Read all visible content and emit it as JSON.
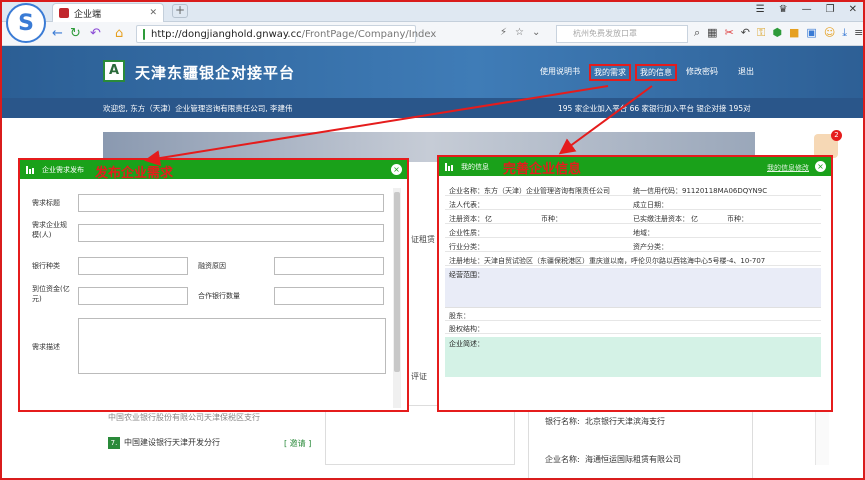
{
  "browser": {
    "tab_title": "企业端",
    "url_host": "http://dongjianghold.gnway.cc",
    "url_path": "/FrontPage/Company/Index",
    "search_placeholder": "杭州免费发放口罩"
  },
  "site": {
    "title": "天津东疆银企对接平台",
    "nav": [
      "使用说明书",
      "我的需求",
      "我的信息",
      "修改密码",
      "退出"
    ],
    "welcome": "欢迎您, 东方（天津）企业管理咨询有限责任公司, 李建伟",
    "stats": "195 家企业加入平台 66 家银行加入平台 银企对接 195对",
    "notification_count": "2"
  },
  "background": {
    "bank_list": [
      {
        "num": "7.",
        "name": "中国建设银行天津开发分行",
        "action": "[ 邀请 ]"
      },
      {
        "num": "",
        "name": "中国农业银行股份有限公司天津保税区支行",
        "action": ""
      }
    ],
    "right_panel": [
      {
        "label": "银行名称:",
        "value": "北京银行天津滨海支行"
      },
      {
        "label": "企业名称:",
        "value": "海通恒运国际租赁有限公司"
      }
    ],
    "behind_text": [
      "证租赁",
      "评证"
    ]
  },
  "demand_dialog": {
    "title": "企业需求发布",
    "annotation": "发布企业需求",
    "fields": {
      "title": "需求标题",
      "scale": "需求企业规模(人)",
      "bank_type": "银行种类",
      "finance_type": "融资原因",
      "amount": "到位资金(亿元)",
      "bank_count": "合作银行数量",
      "desc": "需求描述"
    }
  },
  "info_dialog": {
    "title": "我的信息",
    "annotation": "完善企业信息",
    "top_right": "我的信息修改",
    "rows": {
      "name": "企业名称：东方（天津）企业管理咨询有限责任公司",
      "credit_code": "统一信用代码：91120118MA06DQYN9C",
      "legal": "法人代表：",
      "established": "成立日期：",
      "reg_capital": "注册资本：",
      "reg_unit": "亿",
      "currency": "币种：",
      "paid_capital": "已实缴注册资本：",
      "paid_unit": "亿",
      "currency2": "币种：",
      "nature": "企业性质：",
      "region": "地域：",
      "industry": "行业分类：",
      "asset": "资产分类：",
      "address": "注册地址：天津自贸试验区（东疆保税港区）重庆道以南，呼伦贝尔路以西铭海中心5号楼-4、10-707",
      "scope": "经营范围：",
      "shareholders": "股东：",
      "structure": "股权结构：",
      "intro": "企业简述："
    }
  }
}
